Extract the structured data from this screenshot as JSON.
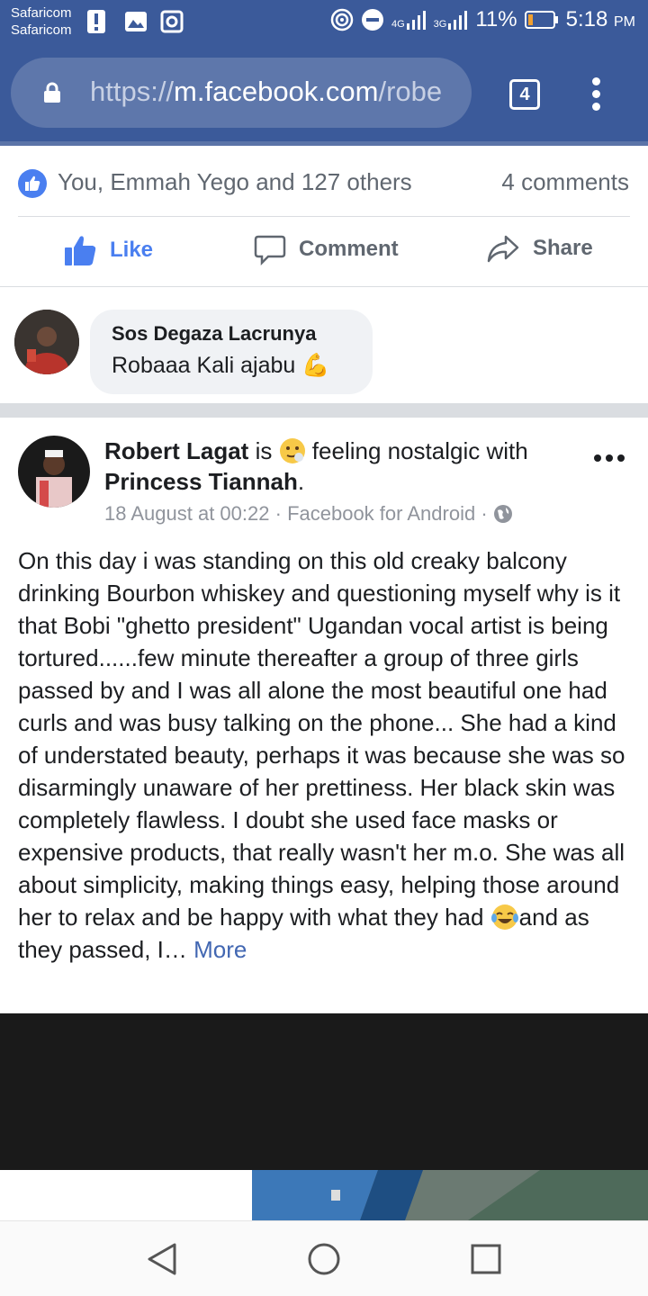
{
  "status_bar": {
    "carrier_1": "Safaricom",
    "carrier_2": "Safaricom",
    "network_1": "4G",
    "network_2": "3G",
    "battery": "11%",
    "time": "5:18",
    "time_suffix": "PM"
  },
  "browser": {
    "url_scheme": "https://",
    "url_host": "m.facebook.com",
    "url_path": "/robe",
    "tab_count": "4"
  },
  "previous_post": {
    "likes_text": "You, Emmah Yego and 127 others",
    "comments_count": "4 comments",
    "actions": {
      "like": "Like",
      "comment": "Comment",
      "share": "Share"
    },
    "comment": {
      "author": "Sos Degaza Lacrunya",
      "text": "Robaaa Kali ajabu",
      "emoji": "💪"
    }
  },
  "post": {
    "author": "Robert Lagat",
    "is_text": " is ",
    "feeling_text": " feeling nostalgic with ",
    "tagged": "Princess Tiannah",
    "period": ".",
    "timestamp": "18 August at 00:22",
    "source": "Facebook for Android",
    "meta_sep": " · ",
    "body_part1": "On this day i was standing on this old creaky balcony drinking Bourbon whiskey and questioning myself why is it that Bobi \"ghetto president\" Ugandan vocal artist is being tortured......few minute thereafter a group of three girls passed by and I was all alone the most beautiful one had curls and was busy talking on the phone... She had a kind of understated beauty, perhaps it was because she was so disarmingly unaware of her prettiness. Her black skin was completely flawless. I doubt she used face masks or expensive products, that really wasn't her m.o. She was all about simplicity, making things easy, helping those around her to relax and be happy with what they had ",
    "body_part2": "and as they passed, I… ",
    "more_label": "More"
  },
  "colors": {
    "facebook_blue": "#3b5a9a",
    "like_blue": "#4a7ff0",
    "text_gray": "#606770",
    "link_blue": "#4267b2"
  }
}
